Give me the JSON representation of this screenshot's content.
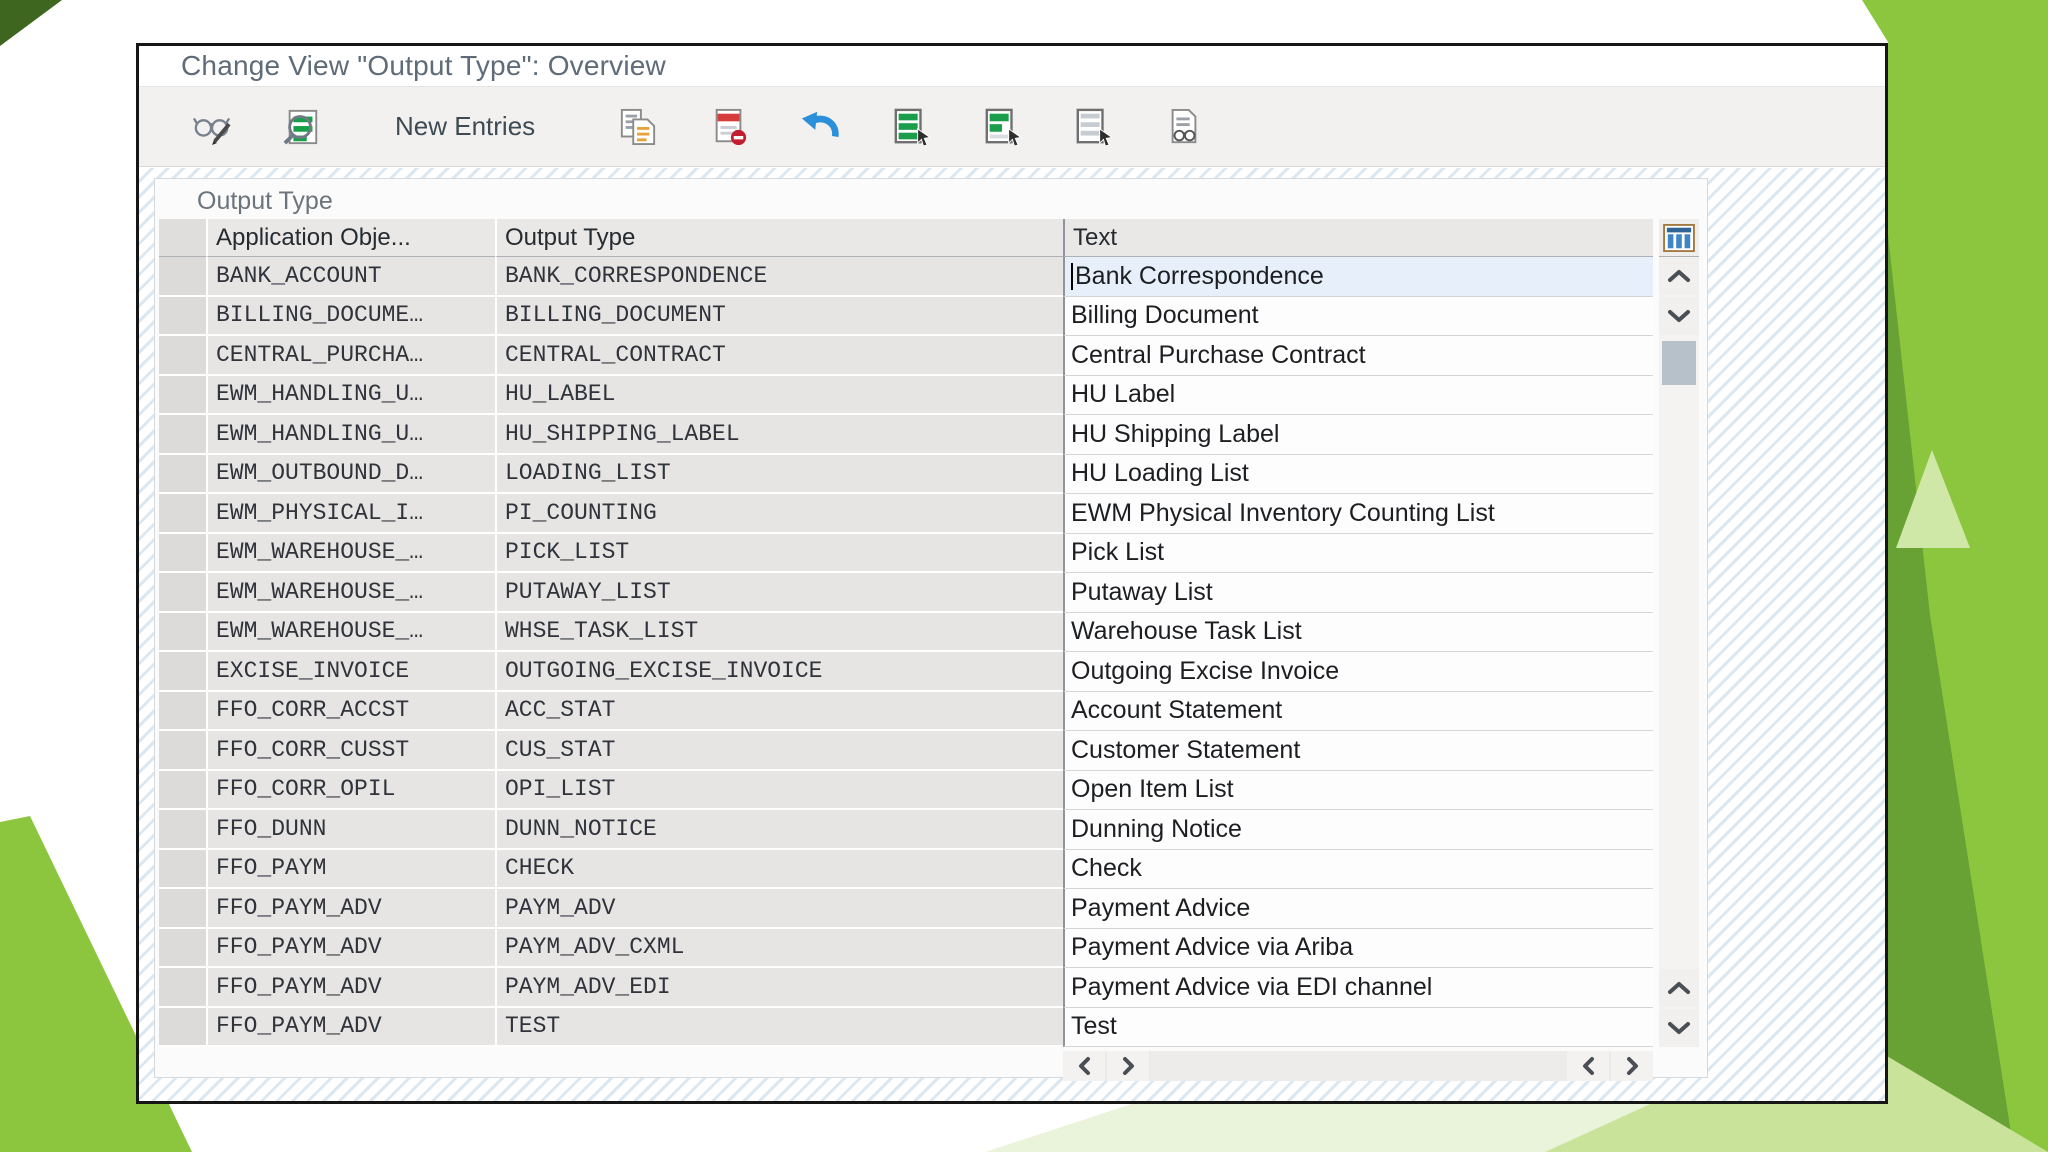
{
  "window": {
    "title": "Change View \"Output Type\": Overview",
    "toolbar": {
      "new_entries_label": "New Entries",
      "icons": [
        "display-change-icon",
        "find-entries-icon",
        "copy-as-icon",
        "delete-icon",
        "undo-icon",
        "select-all-icon",
        "select-block-icon",
        "deselect-all-icon",
        "bc-set-display-icon"
      ]
    },
    "group_box": {
      "label": "Output Type",
      "table": {
        "config_icon": "table-configuration-icon",
        "columns": [
          {
            "key": "app",
            "label": "Application Obje..."
          },
          {
            "key": "type",
            "label": "Output Type"
          },
          {
            "key": "text",
            "label": "Text"
          }
        ],
        "rows": [
          {
            "app": "BANK_ACCOUNT",
            "type": "BANK_CORRESPONDENCE",
            "text": "Bank Correspondence",
            "caret": true
          },
          {
            "app": "BILLING_DOCUME…",
            "type": "BILLING_DOCUMENT",
            "text": "Billing Document"
          },
          {
            "app": "CENTRAL_PURCHA…",
            "type": "CENTRAL_CONTRACT",
            "text": "Central Purchase Contract"
          },
          {
            "app": "EWM_HANDLING_U…",
            "type": "HU_LABEL",
            "text": "HU Label"
          },
          {
            "app": "EWM_HANDLING_U…",
            "type": "HU_SHIPPING_LABEL",
            "text": "HU Shipping Label"
          },
          {
            "app": "EWM_OUTBOUND_D…",
            "type": "LOADING_LIST",
            "text": "HU Loading List"
          },
          {
            "app": "EWM_PHYSICAL_I…",
            "type": "PI_COUNTING",
            "text": "EWM Physical Inventory Counting List"
          },
          {
            "app": "EWM_WAREHOUSE_…",
            "type": "PICK_LIST",
            "text": "Pick List"
          },
          {
            "app": "EWM_WAREHOUSE_…",
            "type": "PUTAWAY_LIST",
            "text": "Putaway List"
          },
          {
            "app": "EWM_WAREHOUSE_…",
            "type": "WHSE_TASK_LIST",
            "text": "Warehouse Task List"
          },
          {
            "app": "EXCISE_INVOICE",
            "type": "OUTGOING_EXCISE_INVOICE",
            "text": "Outgoing Excise Invoice"
          },
          {
            "app": "FFO_CORR_ACCST",
            "type": "ACC_STAT",
            "text": "Account Statement"
          },
          {
            "app": "FFO_CORR_CUSST",
            "type": "CUS_STAT",
            "text": "Customer Statement"
          },
          {
            "app": "FFO_CORR_OPIL",
            "type": "OPI_LIST",
            "text": "Open Item List"
          },
          {
            "app": "FFO_DUNN",
            "type": "DUNN_NOTICE",
            "text": "Dunning Notice"
          },
          {
            "app": "FFO_PAYM",
            "type": "CHECK",
            "text": "Check"
          },
          {
            "app": "FFO_PAYM_ADV",
            "type": "PAYM_ADV",
            "text": "Payment Advice"
          },
          {
            "app": "FFO_PAYM_ADV",
            "type": "PAYM_ADV_CXML",
            "text": "Payment Advice via Ariba"
          },
          {
            "app": "FFO_PAYM_ADV",
            "type": "PAYM_ADV_EDI",
            "text": "Payment Advice via EDI channel"
          },
          {
            "app": "FFO_PAYM_ADV",
            "type": "TEST",
            "text": "Test"
          }
        ]
      }
    },
    "scrollbars": {
      "vertical_icons": [
        "scroll-up-icon",
        "scroll-down-icon",
        "scroll-up-icon",
        "scroll-down-icon"
      ],
      "horizontal_icons": [
        "scroll-left-icon",
        "scroll-right-icon",
        "scroll-left-icon",
        "scroll-right-icon"
      ]
    }
  },
  "decor_colors": {
    "lime_green": "#8cc63e",
    "dark_green": "#68a134",
    "pale_green": "#cfe8a8",
    "corner_green": "#3e661e",
    "canvas_stripe_blue": "#dbe8f2"
  }
}
